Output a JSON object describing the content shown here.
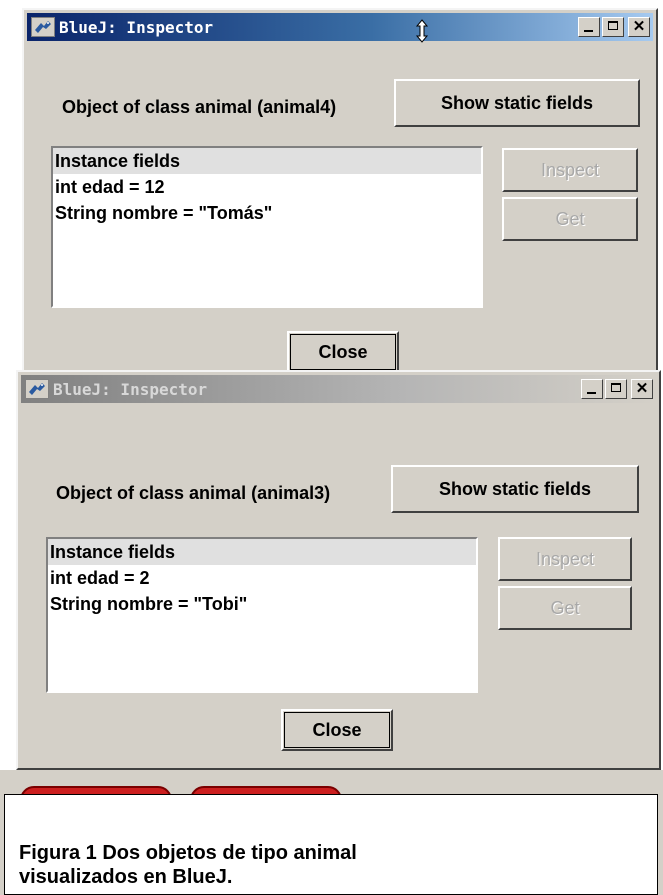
{
  "windows": [
    {
      "title": "BlueJ: Inspector",
      "active": true,
      "object_label": "Object of class animal (animal4)",
      "show_static_label": "Show static fields",
      "fields_header": "Instance fields",
      "fields": [
        "int edad = 12",
        "String nombre = \"Tomás\""
      ],
      "inspect_label": "Inspect",
      "get_label": "Get",
      "close_label": "Close"
    },
    {
      "title": "BlueJ: Inspector",
      "active": false,
      "object_label": "Object of class animal (animal3)",
      "show_static_label": "Show static fields",
      "fields_header": "Instance fields",
      "fields": [
        "int edad = 2",
        "String nombre = \"Tobi\""
      ],
      "inspect_label": "Inspect",
      "get_label": "Get",
      "close_label": "Close"
    }
  ],
  "title_controls": {
    "minimize_icon": "minimize-icon",
    "maximize_icon": "maximize-icon",
    "close_icon": "close-icon"
  },
  "caption": {
    "line1": "Figura 1 Dos objetos de tipo animal",
    "line2": "visualizados en BlueJ."
  },
  "colors": {
    "active_title": "#0a246a",
    "inactive_title": "#808080",
    "window_bg": "#d4d0c8",
    "red_tab": "#cc1f1f"
  }
}
